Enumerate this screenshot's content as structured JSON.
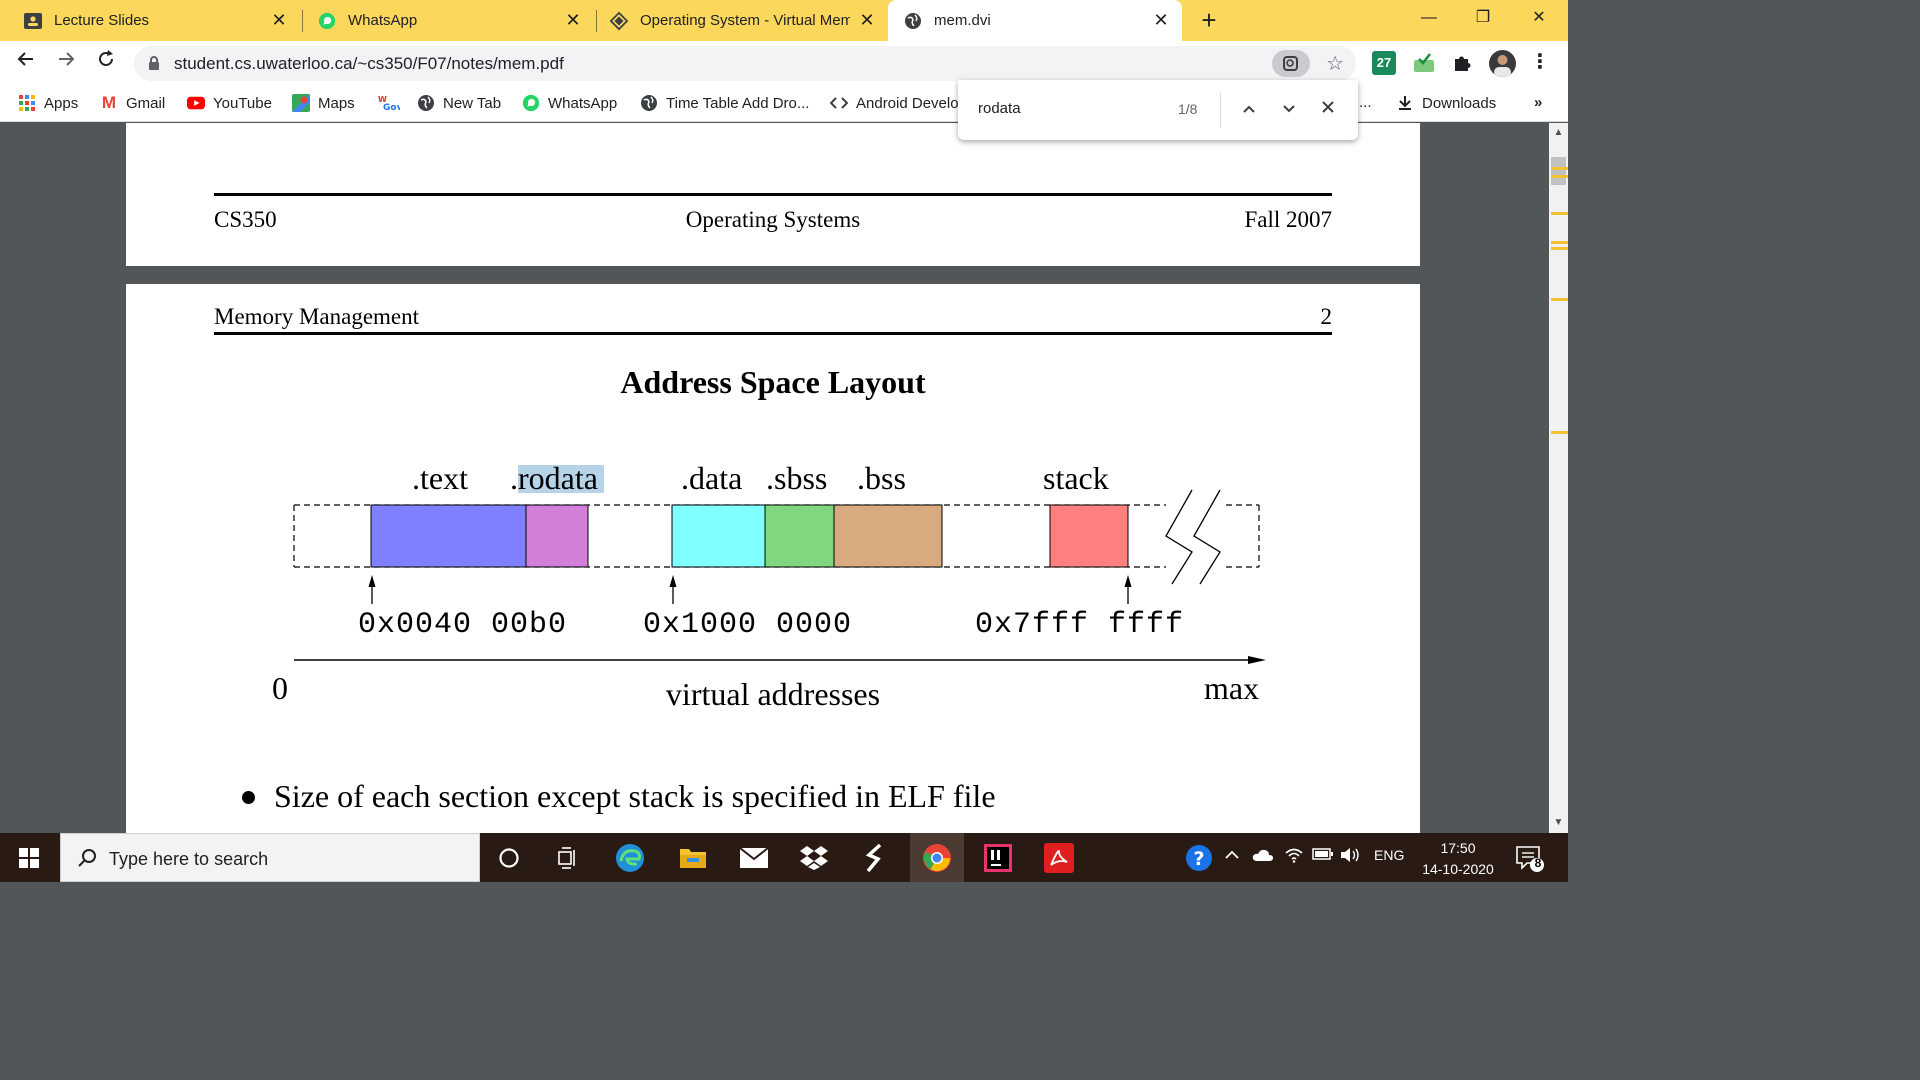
{
  "browser": {
    "tabs": [
      {
        "label": "Lecture Slides",
        "icon": "slides-icon",
        "active": false
      },
      {
        "label": "WhatsApp",
        "icon": "whatsapp-icon",
        "active": false
      },
      {
        "label": "Operating System - Virtual Mem",
        "icon": "site-favicon-icon",
        "active": false
      },
      {
        "label": "mem.dvi",
        "icon": "globe-icon",
        "active": true
      }
    ],
    "url": "student.cs.uwaterloo.ca/~cs350/F07/notes/mem.pdf",
    "extension_badge": "27",
    "bookmarks": [
      "Apps",
      "Gmail",
      "YouTube",
      "Maps",
      "New Tab",
      "WhatsApp",
      "Time Table Add Dro...",
      "Android Develo",
      "Downloads"
    ],
    "bookmark_overflow": "»",
    "hidden_bookmark_tail": "..."
  },
  "find_bar": {
    "query": "rodata",
    "count": "1/8"
  },
  "pdf": {
    "page1_header": {
      "left": "CS350",
      "center": "Operating Systems",
      "right": "Fall 2007"
    },
    "page2_header": {
      "left": "Memory Management",
      "right": "2"
    },
    "slide_title": "Address Space Layout",
    "diagram": {
      "sections": [
        ".text",
        ".rodata",
        ".data",
        ".sbss",
        ".bss",
        "stack"
      ],
      "section_colors": {
        ".text": "#7f7fff",
        ".rodata": "#d27fd8",
        ".data": "#7fffff",
        ".sbss": "#7fd87f",
        ".bss": "#d8aa7f",
        "stack": "#ff7f7f"
      },
      "addresses": [
        "0x0040 00b0",
        "0x1000 0000",
        "0x7fff ffff"
      ],
      "axis_start": "0",
      "axis_label": "virtual addresses",
      "axis_end": "max"
    },
    "bullet": "Size of each section except stack is specified in ELF file"
  },
  "taskbar": {
    "search_placeholder": "Type here to search",
    "language": "ENG",
    "time": "17:50",
    "date": "14-10-2020",
    "notification_count": "8"
  }
}
